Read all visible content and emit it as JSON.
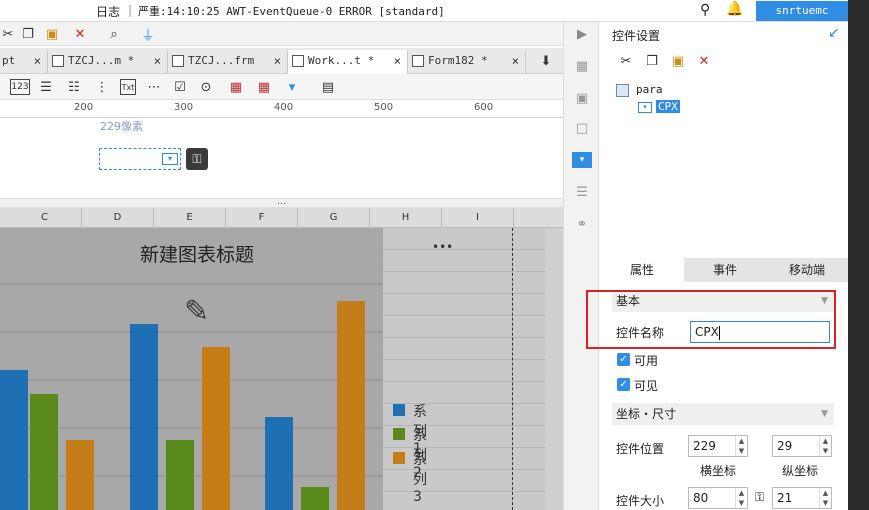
{
  "topbar": {
    "log_label": "日志",
    "separator": "|",
    "error_text": "严重:14:10:25 AWT-EventQueue-0 ERROR [standard]",
    "user": "snrtuemc"
  },
  "tabs": [
    {
      "label": "pt",
      "close": "×"
    },
    {
      "label": "TZCJ...m *",
      "close": "×"
    },
    {
      "label": "TZCJ...frm",
      "close": "×"
    },
    {
      "label": "Work...t *",
      "close": "×"
    },
    {
      "label": "Form182 *",
      "close": "×"
    }
  ],
  "ruler": {
    "ticks": [
      "200",
      "300",
      "400",
      "500",
      "600"
    ]
  },
  "form": {
    "width_hint": "229像素"
  },
  "splitter": "...",
  "sheet": {
    "columns": [
      "C",
      "D",
      "E",
      "F",
      "G",
      "H",
      "I"
    ]
  },
  "chart_data": {
    "type": "bar",
    "title": "新建图表标题",
    "more": "•••",
    "series": [
      {
        "name": "系列1",
        "color": "#1f6fb5"
      },
      {
        "name": "系列2",
        "color": "#5a8a1a"
      },
      {
        "name": "系列3",
        "color": "#c57d1a"
      }
    ]
  },
  "panel": {
    "title": "控件设置",
    "tree_root": "para",
    "tree_child": "CPX",
    "tabs": [
      "属性",
      "事件",
      "移动端"
    ],
    "section_basic": "基本",
    "name_label": "控件名称",
    "name_value": "CPX",
    "enabled_label": "可用",
    "visible_label": "可见",
    "section_geom": "坐标・尺寸",
    "pos_label": "控件位置",
    "pos_x": "229",
    "pos_y": "29",
    "x_label": "横坐标",
    "y_label": "纵坐标",
    "size_label": "控件大小",
    "size_w": "80",
    "size_h": "21"
  },
  "colors": {
    "accent": "#2f8de4",
    "highlight": "#e02020"
  }
}
